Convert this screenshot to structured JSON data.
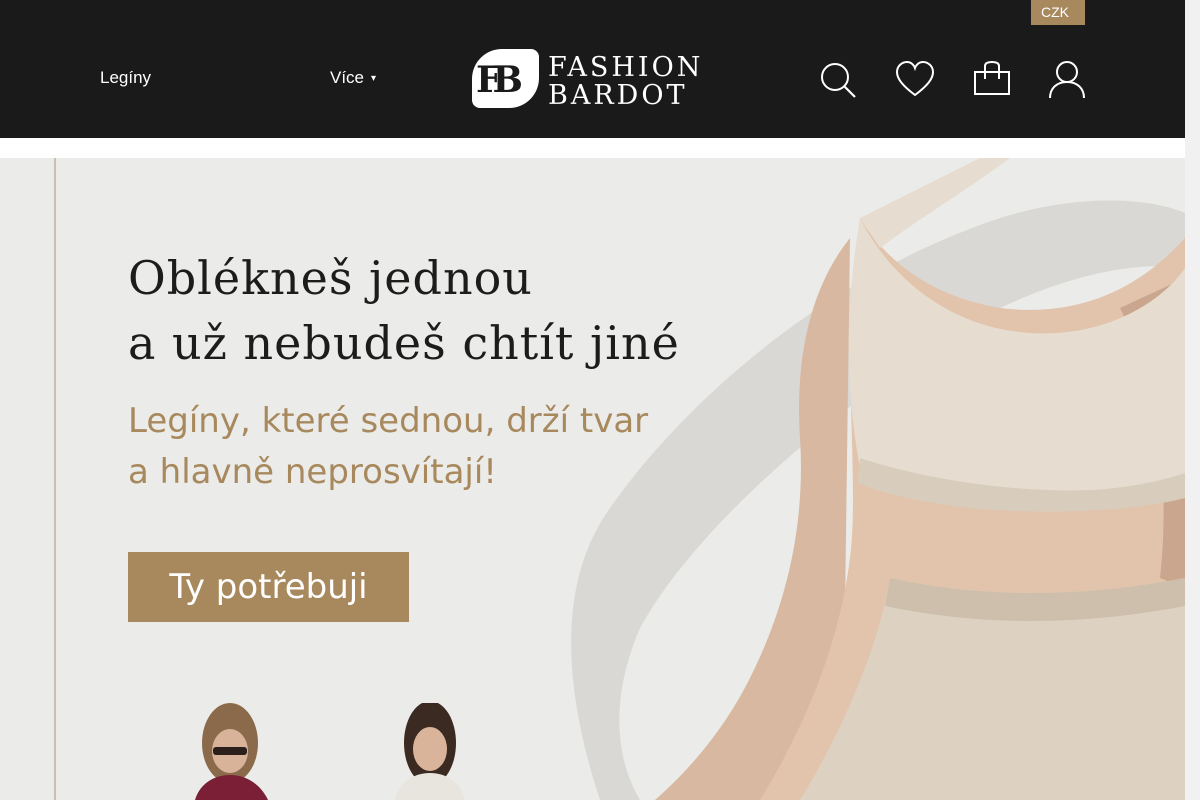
{
  "header": {
    "currency": "CZK",
    "nav": [
      {
        "label": "Legíny"
      },
      {
        "label": "Více",
        "caret": "chevron-down-icon"
      }
    ],
    "logo": {
      "monogram": "FB",
      "line1": "FASHION",
      "line2": "BARDOT"
    },
    "icons": [
      "search-icon",
      "heart-icon",
      "shopping-bag-icon",
      "user-icon"
    ]
  },
  "hero": {
    "headline_line1": "Oblékneš jednou",
    "headline_line2": "a už nebudeš chtít jiné",
    "subhead_line1": "Legíny, které sednou, drží tvar",
    "subhead_line2": "a hlavně neprosvítají!",
    "cta_label": "Ty potřebuji"
  },
  "colors": {
    "header_bg": "#1a1a1a",
    "accent": "#a8895d",
    "hero_bg": "#ebebe9",
    "headline": "#1c1c1c"
  }
}
